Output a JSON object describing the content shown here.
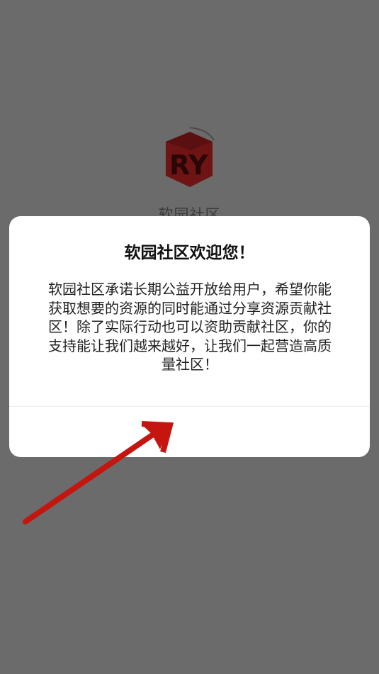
{
  "app": {
    "name": "软园社区",
    "logo_text": "RY"
  },
  "dialog": {
    "title": "软园社区欢迎您！",
    "body": "软园社区承诺长期公益开放给用户，希望你能获取想要的资源的同时能通过分享资源贡献社区！除了实际行动也可以资助贡献社区，你的支持能让我们越来越好，让我们一起营造高质量社区！",
    "button_label": ""
  },
  "colors": {
    "overlay": "#6b6b6b",
    "logo": "#6e1414",
    "arrow": "#c4150f",
    "dialog_bg": "#ffffff"
  },
  "icons": {
    "logo": "ry-cube-logo",
    "annotation": "red-arrow"
  }
}
